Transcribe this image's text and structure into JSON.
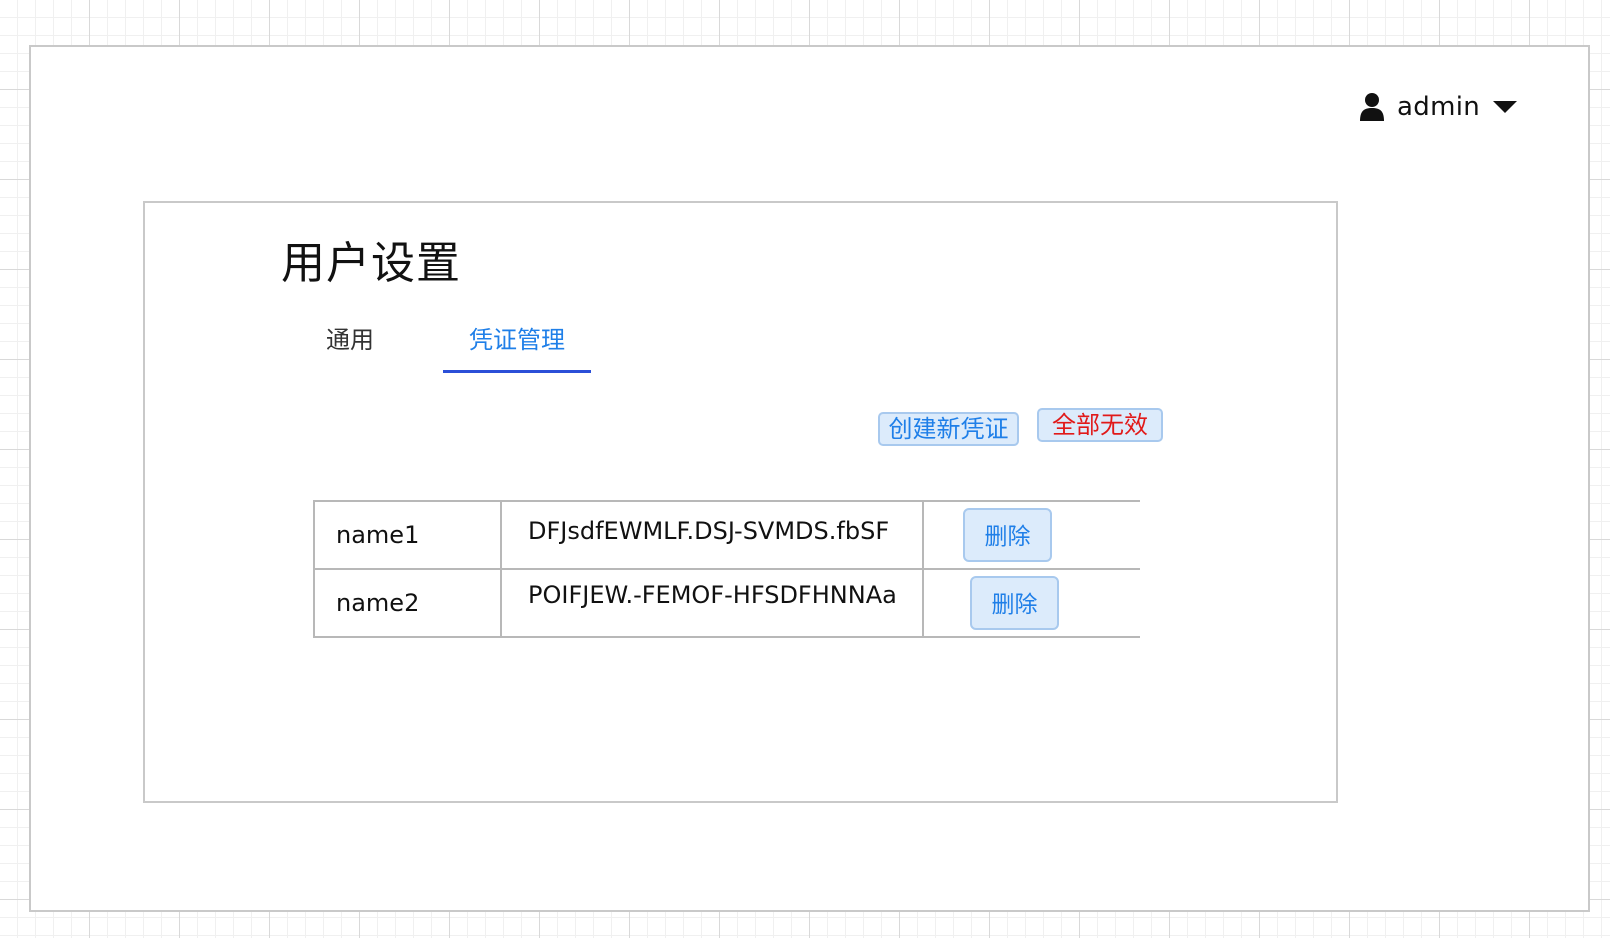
{
  "user_menu": {
    "icon": "user-icon",
    "username": "admin",
    "caret_icon": "caret-down-icon"
  },
  "settings": {
    "title": "用户设置",
    "tabs": [
      {
        "label": "通用",
        "active": false
      },
      {
        "label": "凭证管理",
        "active": true
      }
    ],
    "actions": {
      "create_label": "创建新凭证",
      "invalidate_all_label": "全部无效"
    },
    "credentials": [
      {
        "name": "name1",
        "token": "DFJsdfEWMLF.DSJ-SVMDS.fbSF",
        "delete_label": "删除"
      },
      {
        "name": "name2",
        "token": "POIFJEW.-FEMOF-HFSDFHNNAa",
        "delete_label": "删除"
      }
    ]
  },
  "colors": {
    "accent": "#1f7fe8",
    "active_tab_underline": "#2b4fd8",
    "danger": "#e11919",
    "button_fill": "#dcebfb",
    "button_border": "#a8c9ee",
    "border": "#c9c9c9"
  }
}
